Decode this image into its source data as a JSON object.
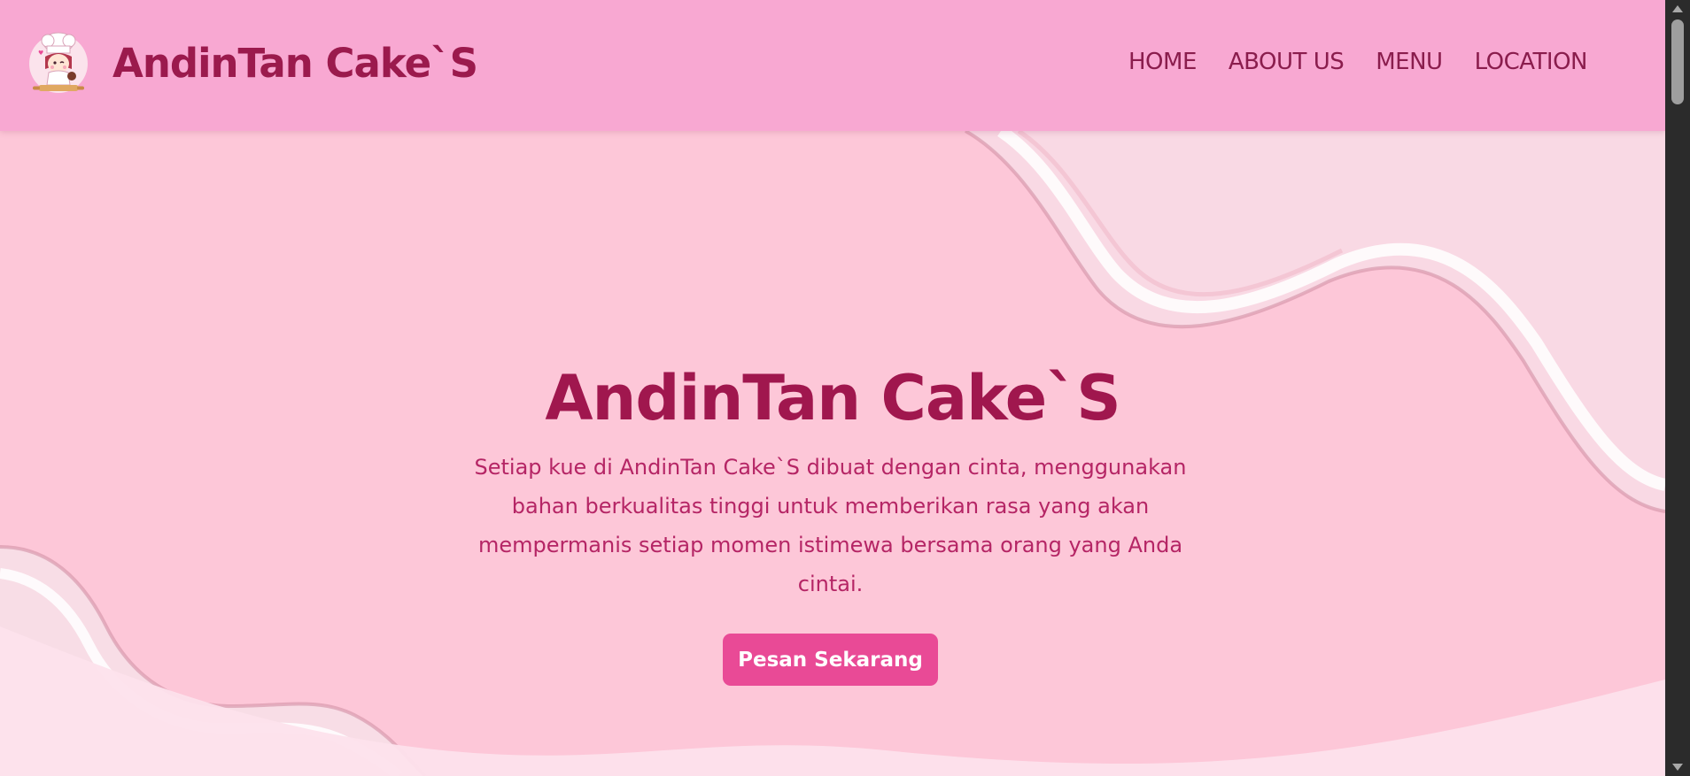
{
  "header": {
    "brand": "AndinTan Cake`S",
    "nav": [
      {
        "label": "HOME"
      },
      {
        "label": "ABOUT US"
      },
      {
        "label": "MENU"
      },
      {
        "label": "LOCATION"
      }
    ]
  },
  "hero": {
    "title": "AndinTan Cake`S",
    "description": "Setiap kue di AndinTan Cake`S dibuat dengan cinta, menggunakan bahan berkualitas tinggi untuk memberikan rasa yang akan mempermanis setiap momen istimewa bersama orang yang Anda cintai.",
    "cta_label": "Pesan Sekarang"
  },
  "colors": {
    "header_bg": "#f8a8d2",
    "hero_bg": "#fcd1df",
    "title": "#a0174e",
    "text": "#b52565",
    "cta_bg": "#e94a96",
    "scrollbar": "#2b2b2b"
  },
  "icons": {
    "logo": "chef-logo-icon"
  }
}
